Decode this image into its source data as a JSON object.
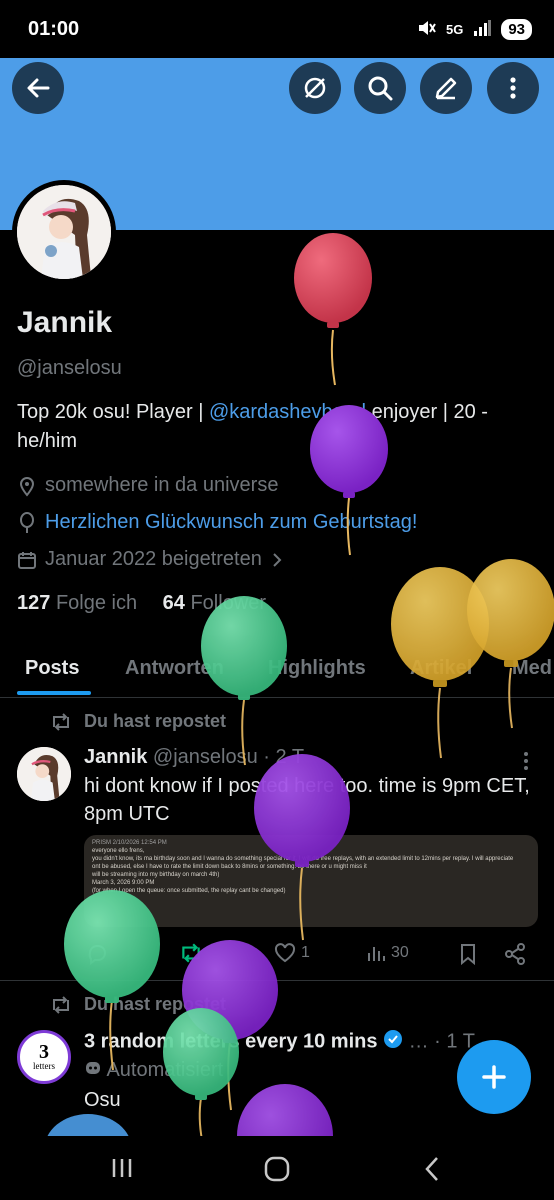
{
  "status_bar": {
    "time": "01:00",
    "network": "5G",
    "battery": "93"
  },
  "header": {
    "icons": [
      "back-arrow-icon",
      "grok-icon",
      "search-icon",
      "edit-icon",
      "more-icon"
    ]
  },
  "profile": {
    "name": "Jannik",
    "handle": "@janselosu",
    "bio_prefix": "Top 20k osu! Player | ",
    "bio_link": "@kardashevband",
    "bio_suffix": " enjoyer | 20 - he/him",
    "location": "somewhere in da universe",
    "birthday": "Herzlichen Glückwunsch zum Geburtstag!",
    "joined": "Januar 2022 beigetreten",
    "following_count": "127",
    "following_label": "Folge ich",
    "followers_count": "64",
    "followers_label": "Follower"
  },
  "tabs": [
    "Posts",
    "Antworten",
    "Highlights",
    "Artikel",
    "Med"
  ],
  "posts": [
    {
      "repost_label": "Du hast repostet",
      "author": "Jannik",
      "handle": "@janselosu",
      "time": "· 2 T",
      "text": "hi dont know if I posted here too. time is 9pm CET, 8pm UTC",
      "attachment": {
        "header": "PRISM  2/10/2026 12:54 PM",
        "line1": "everyone ello frens,",
        "line2": "you didn't know, its ma birthday soon and I wanna do something special for it. I will do free replays, with an extended limit to 12mins per replay. I will appreciate",
        "line3": "ont be abused, else I have to rate the limit down back to 8mins or something. be there or u might miss it",
        "line4": "will be streaming into my birthday on march 4th)",
        "line5": "March 3, 2026 9:00 PM",
        "line6": "(for when I open the queue: once submitted, the replay cant be changed)"
      },
      "likes": "1",
      "views": "30"
    },
    {
      "repost_label": "Du hast repostet",
      "author": "3 random letters every 10 mins",
      "time": "· 1 T",
      "automated": "Automatisiert",
      "text": "Osu",
      "avatar_text": "3",
      "avatar_subtext": "letters"
    }
  ],
  "colors": {
    "banner": "#4d9de8",
    "accent": "#1d9bf0",
    "balloon_red": "#d9445a",
    "balloon_purple": "#8a2fd0",
    "balloon_green": "#4fd195",
    "balloon_yellow": "#e6b93a"
  }
}
